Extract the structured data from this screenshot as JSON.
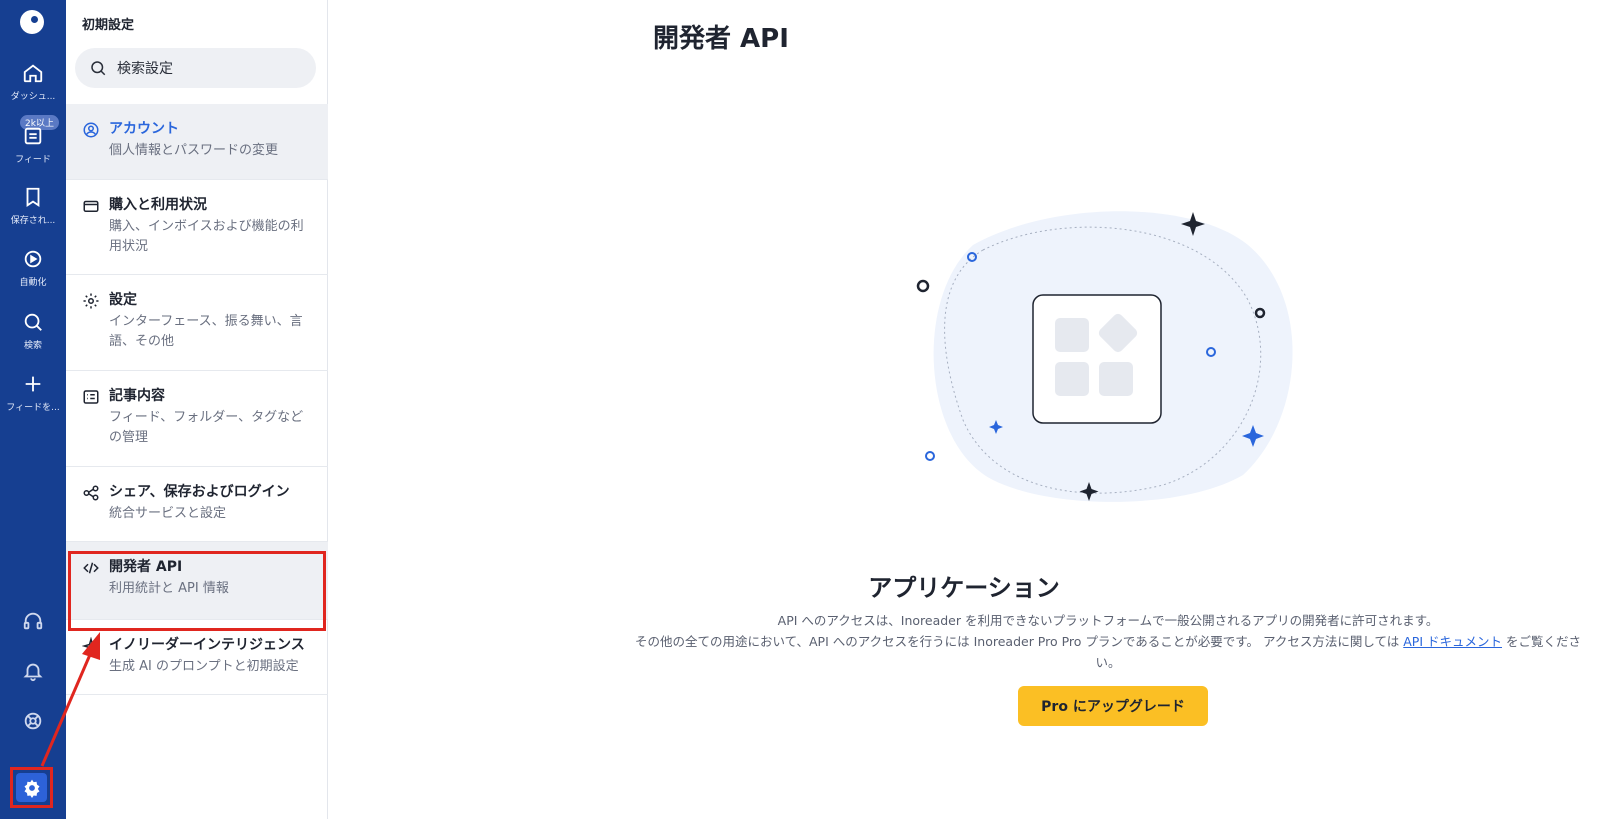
{
  "rail": {
    "items": [
      {
        "label": "ダッシュ...",
        "icon": "home-icon"
      },
      {
        "label": "フィード",
        "icon": "feed-icon",
        "badge": "2k以上"
      },
      {
        "label": "保存され...",
        "icon": "bookmark-icon"
      },
      {
        "label": "自動化",
        "icon": "automation-icon"
      },
      {
        "label": "検索",
        "icon": "search-icon"
      },
      {
        "label": "フィードを...",
        "icon": "plus-icon"
      }
    ],
    "bottom_icons": [
      "headphones-icon",
      "bell-icon",
      "help-icon",
      "gear-icon"
    ]
  },
  "panel": {
    "title": "初期設定",
    "search_text": "検索設定",
    "items": [
      {
        "title": "アカウント",
        "sub": "個人情報とパスワードの変更",
        "icon": "user-circle-icon"
      },
      {
        "title": "購入と利用状況",
        "sub": "購入、インボイスおよび機能の利用状況",
        "icon": "card-icon"
      },
      {
        "title": "設定",
        "sub": "インターフェース、振る舞い、言語、その他",
        "icon": "gear-icon"
      },
      {
        "title": "記事内容",
        "sub": "フィード、フォルダー、タグなどの管理",
        "icon": "list-icon"
      },
      {
        "title": "シェア、保存およびログイン",
        "sub": "統合サービスと設定",
        "icon": "share-icon"
      },
      {
        "title": "開発者 API",
        "sub": "利用統計と API 情報",
        "icon": "code-icon"
      },
      {
        "title": "イノリーダーインテリジェンス",
        "sub": "生成 AI のプロンプトと初期設定",
        "icon": "sparkle-icon"
      }
    ]
  },
  "main": {
    "title": "開発者 API",
    "heading": "アプリケーション",
    "desc_line1": "API へのアクセスは、Inoreader を利用できないプラットフォームで一般公開されるアプリの開発者に許可されます。",
    "desc_line2": "その他の全ての用途において、API へのアクセスを行うには Inoreader Pro Pro プランであることが必要です。 アクセス方法に関しては",
    "desc_link": "API ドキュメント",
    "desc_tail": "をご覧ください。",
    "upgrade_label": "Pro にアップグレード"
  },
  "colors": {
    "rail": "#163f91",
    "accent": "#2a66dc",
    "upgrade": "#fbbf24",
    "highlight": "#e0261f"
  }
}
